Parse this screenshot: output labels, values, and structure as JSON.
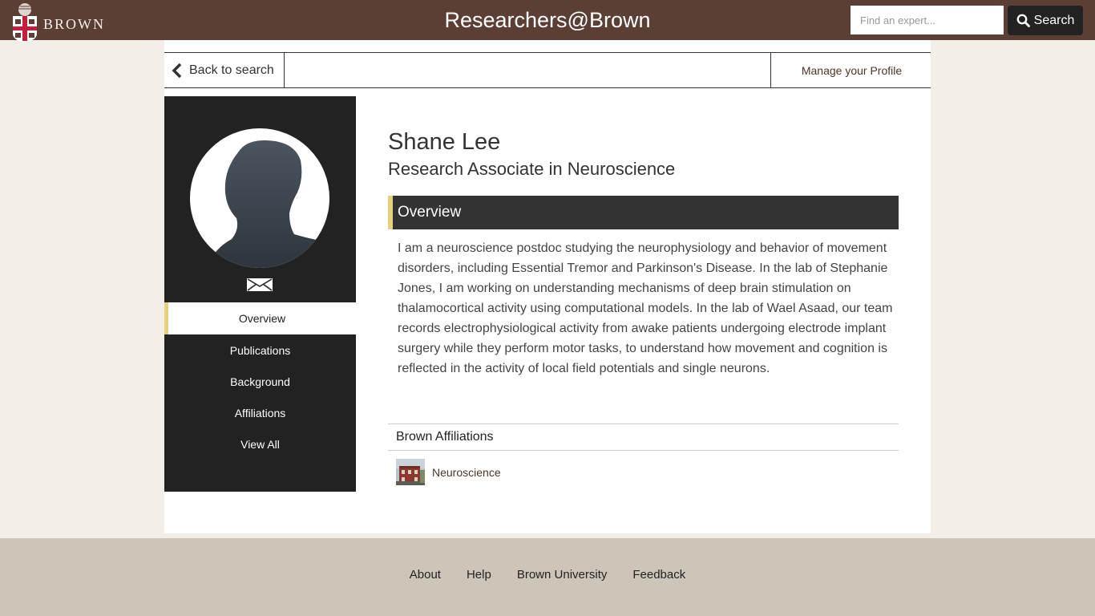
{
  "header": {
    "logo_text": "BROWN",
    "site_title": "Researchers@Brown",
    "search_placeholder": "Find an expert...",
    "search_button_label": "Search"
  },
  "subnav": {
    "back_label": "Back to search",
    "manage_label": "Manage your Profile"
  },
  "sidebar": {
    "items": [
      {
        "label": "Overview",
        "active": true
      },
      {
        "label": "Publications",
        "active": false
      },
      {
        "label": "Background",
        "active": false
      },
      {
        "label": "Affiliations",
        "active": false
      },
      {
        "label": "View All",
        "active": false
      }
    ]
  },
  "profile": {
    "name": "Shane Lee",
    "title": "Research Associate in Neuroscience",
    "overview_heading": "Overview",
    "overview_text": "I am a neuroscience postdoc studying the neurophysiology and behavior of movement disorders, including Essential Tremor and Parkinson's Disease. In the lab of Stephanie Jones, I am working on understanding mechanisms of deep brain stimulation on thalamocortical activity using computational models. In the lab of Wael Asaad, our team records electrophysiological activity from awake patients undergoing electrode implant surgery while they perform motor tasks, to understand how movement and cognition is reflected in the activity of local field potentials and single neurons.",
    "affiliations_heading": "Brown Affiliations",
    "affiliations": [
      {
        "label": "Neuroscience"
      }
    ]
  },
  "footer": {
    "links": [
      "About",
      "Help",
      "Brown University",
      "Feedback"
    ]
  },
  "colors": {
    "header_bg": "#5b3f35",
    "accent_gold": "#e6d17e",
    "sidebar_bg": "#222222",
    "page_bg": "#f3efe8",
    "footer_bg": "#cdc5b8",
    "link_brown": "#4e3629"
  },
  "icons": {
    "logo": "brown-shield-icon",
    "search": "search-icon",
    "back": "chevron-left-icon",
    "email": "envelope-icon",
    "avatar": "person-silhouette-icon"
  }
}
